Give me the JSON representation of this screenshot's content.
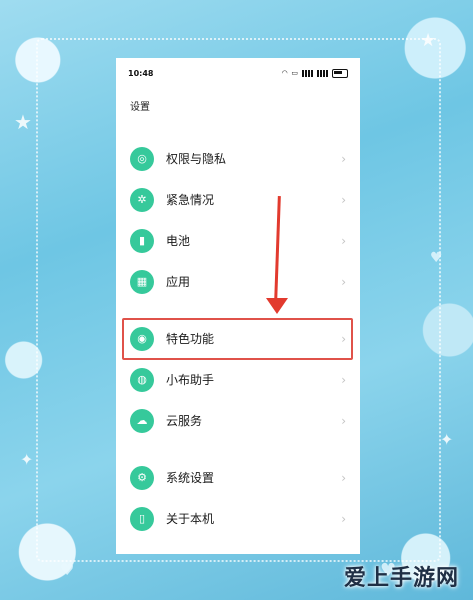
{
  "status_bar": {
    "time": "10:48",
    "icons": [
      "wifi-icon",
      "nfc-icon",
      "signal-icon",
      "signal-icon",
      "battery-icon"
    ]
  },
  "settings": {
    "title": "设置",
    "items": [
      {
        "label": "权限与隐私",
        "icon": "privacy-icon"
      },
      {
        "label": "紧急情况",
        "icon": "emergency-icon"
      },
      {
        "label": "电池",
        "icon": "battery-icon"
      },
      {
        "label": "应用",
        "icon": "apps-icon"
      },
      {
        "label": "特色功能",
        "icon": "special-features-icon"
      },
      {
        "label": "小布助手",
        "icon": "assistant-icon"
      },
      {
        "label": "云服务",
        "icon": "cloud-icon"
      },
      {
        "label": "系统设置",
        "icon": "system-settings-icon"
      },
      {
        "label": "关于本机",
        "icon": "about-phone-icon"
      }
    ],
    "chevron": "›"
  },
  "annotation": {
    "highlighted_item": "特色功能",
    "color": "#e0524a"
  },
  "watermark": "爱上手游网",
  "colors": {
    "icon_bg": "#36c99b",
    "frame": "#8fd3ea",
    "arrow": "#e23a2e"
  }
}
